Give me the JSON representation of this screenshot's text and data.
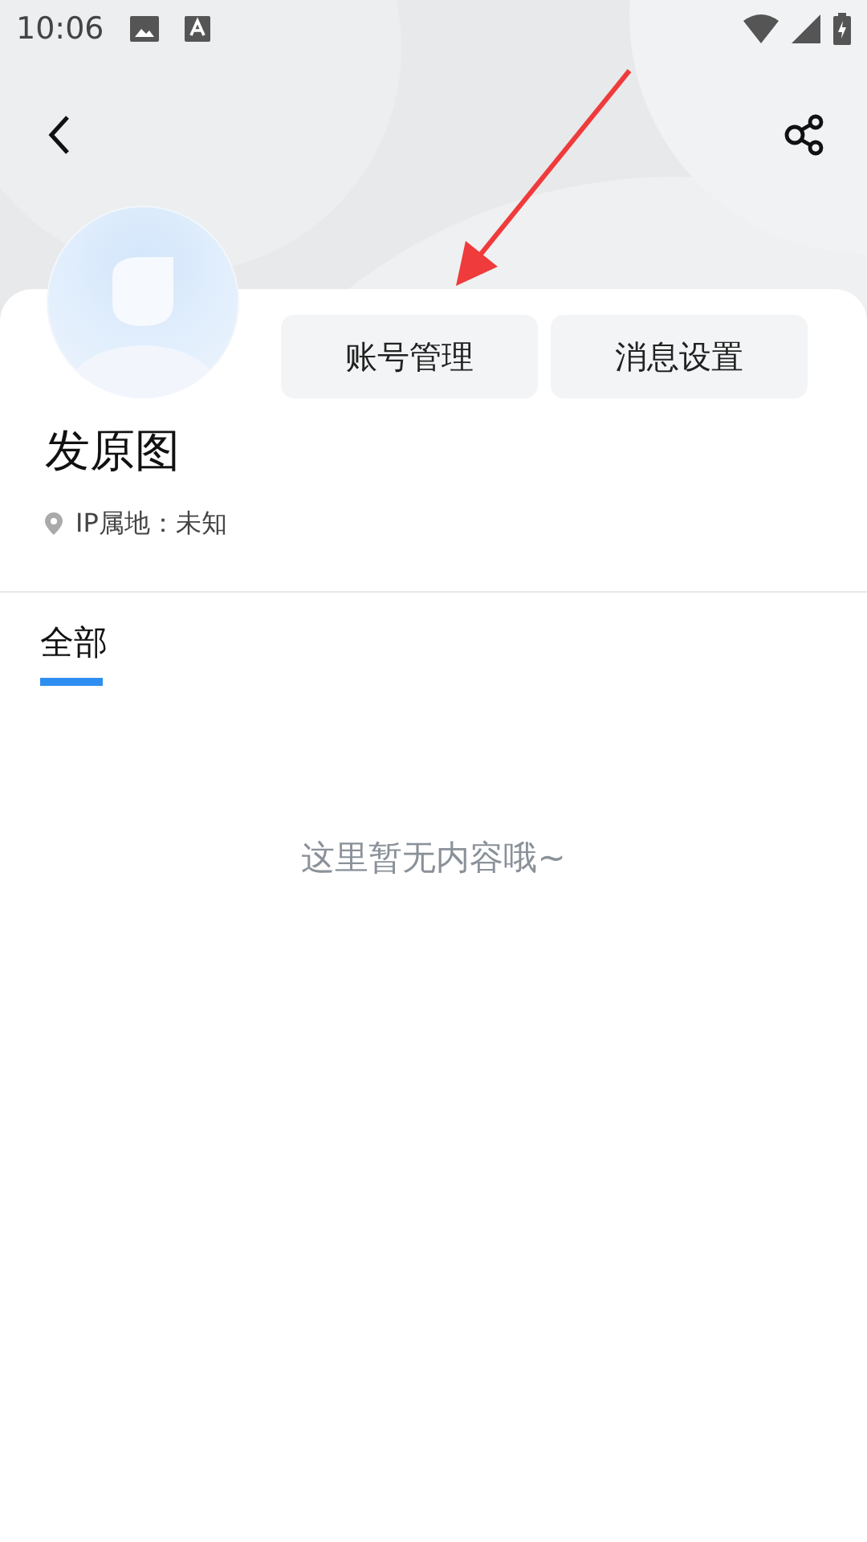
{
  "status_bar": {
    "time": "10:06"
  },
  "actions": [
    {
      "label": "账号管理"
    },
    {
      "label": "消息设置"
    }
  ],
  "profile": {
    "name": "发原图",
    "ip_location": "IP属地：未知"
  },
  "tabs": [
    {
      "label": "全部",
      "selected": true
    }
  ],
  "empty_message": "这里暂无内容哦~"
}
